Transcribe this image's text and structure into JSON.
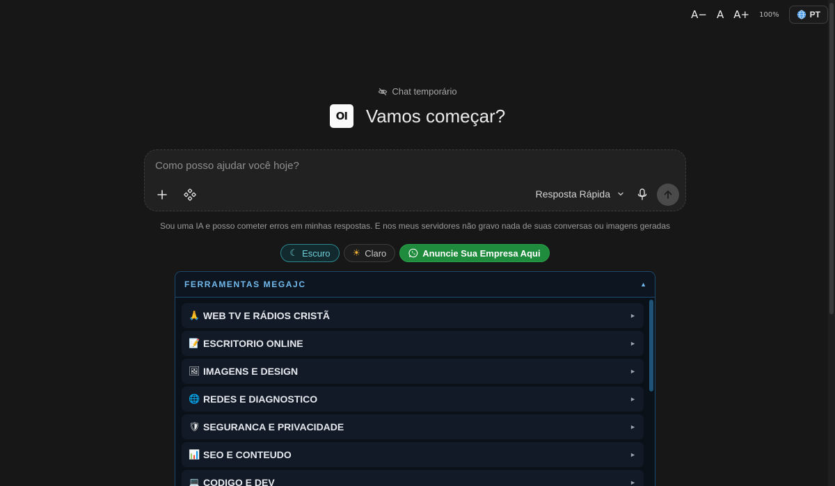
{
  "a11y": {
    "decrease": "A−",
    "reset": "A",
    "increase": "A+",
    "zoom": "100%",
    "language": "PT"
  },
  "header": {
    "temp_chat": "Chat temporário",
    "logo_text": "OI",
    "headline": "Vamos começar?"
  },
  "chat": {
    "placeholder": "Como posso ajudar você hoje?",
    "mode": "Resposta Rápida"
  },
  "disclaimer": "Sou uma IA e posso cometer erros em minhas respostas. E nos meus servidores não gravo nada de suas conversas ou imagens geradas",
  "theme": {
    "dark_label": "Escuro",
    "dark_icon": "☾",
    "light_label": "Claro",
    "light_icon": "☀",
    "whatsapp_label": "Anuncie Sua Empresa Aqui"
  },
  "tools": {
    "title": "FERRAMENTAS MEGAJC",
    "collapse_icon": "▲",
    "arrow_icon": "►",
    "items": [
      {
        "emoji": "🙏",
        "label": "WEB TV E RÁDIOS CRISTÃ"
      },
      {
        "emoji": "📝",
        "label": "ESCRITORIO ONLINE"
      },
      {
        "emoji": "🖼",
        "label": "IMAGENS E DESIGN"
      },
      {
        "emoji": "🌐",
        "label": "REDES E DIAGNOSTICO"
      },
      {
        "emoji": "🛡",
        "label": "SEGURANCA E PRIVACIDADE"
      },
      {
        "emoji": "📊",
        "label": "SEO E CONTEUDO"
      },
      {
        "emoji": "💻",
        "label": "CODIGO E DEV"
      }
    ]
  },
  "colors": {
    "background": "#171717",
    "accent_teal": "#2b8891",
    "whatsapp_green": "#1f8b3c",
    "panel_border": "#1c4a6e",
    "panel_title": "#72b9ec"
  }
}
